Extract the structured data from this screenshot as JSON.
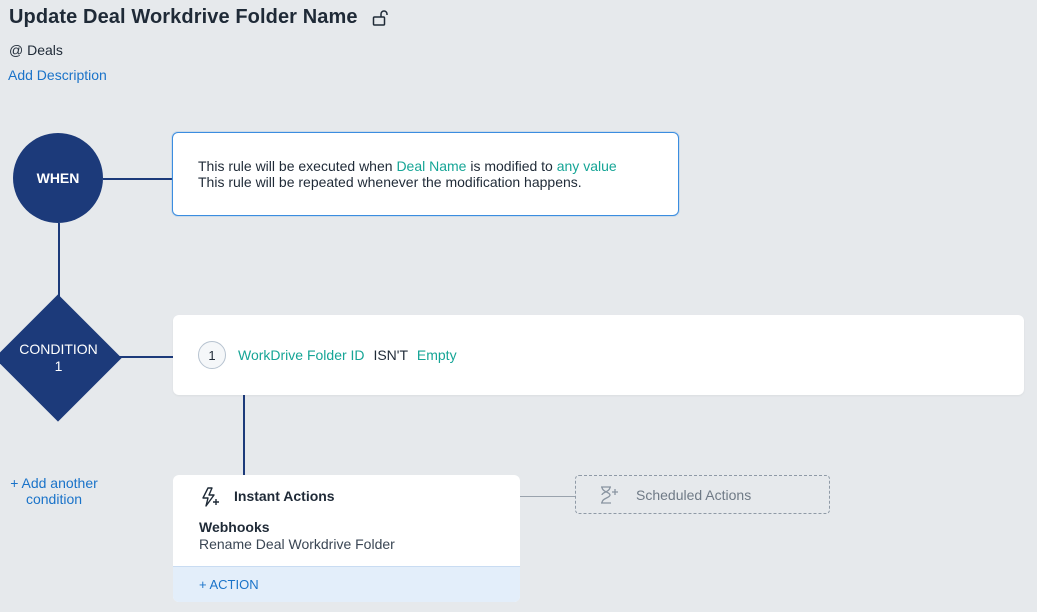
{
  "header": {
    "title": "Update Deal Workdrive Folder Name",
    "module": "@ Deals",
    "add_description": "Add Description"
  },
  "icons": {
    "lock": "unlock-icon",
    "instant": "lightning-plus-icon",
    "scheduled": "hourglass-plus-icon"
  },
  "when": {
    "node_label": "WHEN",
    "line1_prefix": "This rule will be executed when",
    "field": "Deal Name",
    "line1_middle": "is modified to",
    "value": "any value",
    "line2": "This rule will be repeated whenever the modification happens."
  },
  "condition": {
    "node_label_line1": "CONDITION",
    "node_label_line2": "1",
    "number": "1",
    "field": "WorkDrive Folder ID",
    "operator": "ISN'T",
    "value": "Empty",
    "add_another_line1": "+ Add another",
    "add_another_line2": "condition"
  },
  "instant_actions": {
    "title": "Instant Actions",
    "type": "Webhooks",
    "name": "Rename Deal Workdrive Folder",
    "add_action": "+ ACTION"
  },
  "scheduled_actions": {
    "label": "Scheduled Actions"
  },
  "colors": {
    "node": "#1c3a7a",
    "accent_teal": "#16a596",
    "link_blue": "#1a73c9"
  }
}
